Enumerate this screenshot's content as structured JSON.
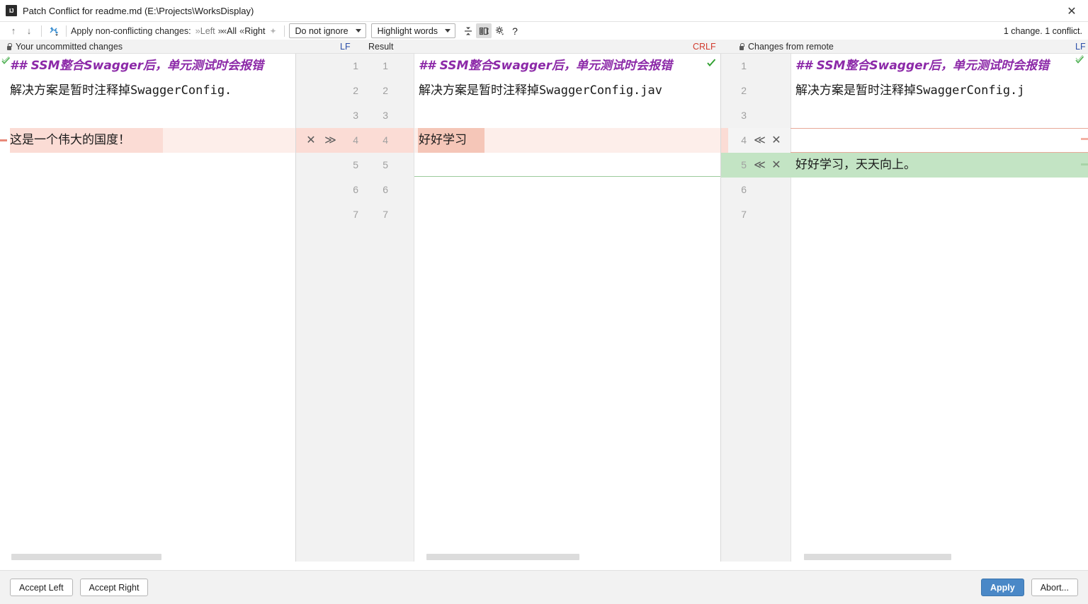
{
  "window": {
    "title": "Patch Conflict for readme.md (E:\\Projects\\WorksDisplay)",
    "app_icon": "intellij-idea-icon",
    "close_label": "✕"
  },
  "toolbar": {
    "prev_change_icon": "arrow-up-icon",
    "next_change_icon": "arrow-down-icon",
    "resolve_icon": "magic-resolve-icon",
    "apply_label": "Apply non-conflicting changes:",
    "apply_left": "Left",
    "apply_all": "All",
    "apply_right": "Right",
    "magic_icon": "magic-wand-icon",
    "ignore_select": "Do not ignore",
    "highlight_select": "Highlight words",
    "collapse_icon": "collapse-unchanged-icon",
    "sync_scroll_icon": "synchronize-scroll-icon",
    "settings_icon": "gear-icon",
    "help_icon": "help-icon",
    "status": "1 change. 1 conflict."
  },
  "panes": {
    "left": {
      "header": "Your uncommitted changes",
      "lock_icon": "lock-icon",
      "lines": [
        {
          "n": "",
          "text": "##  SSM整合Swagger后，单元测试时会报错",
          "style": "md-head"
        },
        {
          "n": "",
          "text": "解决方案是暂时注释掉SwaggerConfig.",
          "style": "plain"
        },
        {
          "n": "",
          "text": "",
          "style": "plain"
        },
        {
          "n": "",
          "text": "这是一个伟大的国度！",
          "style": "plain"
        }
      ]
    },
    "result": {
      "header_lf": "LF",
      "header_result": "Result",
      "header_crlf": "CRLF",
      "line_numbers_left": [
        "1",
        "2",
        "3",
        "4",
        "5",
        "6",
        "7"
      ],
      "line_numbers_right": [
        "1",
        "2",
        "3",
        "4",
        "5",
        "6",
        "7"
      ],
      "lines": [
        {
          "text": "##  SSM整合Swagger后，单元测试时会报错",
          "style": "md-head"
        },
        {
          "text": "解决方案是暂时注释掉SwaggerConfig.jav",
          "style": "plain"
        },
        {
          "text": "",
          "style": "plain"
        },
        {
          "text": "好好学习",
          "style": "plain"
        },
        {
          "text": "",
          "style": "plain"
        }
      ],
      "gutter_actions": {
        "revert_icon": "✕",
        "accept_right_icon": "≫"
      }
    },
    "right": {
      "header": "Changes from remote",
      "lock_icon": "lock-icon",
      "header_lf": "LF",
      "line_numbers": [
        "1",
        "2",
        "3",
        "4",
        "5",
        "6",
        "7"
      ],
      "lines": [
        {
          "text": "##  SSM整合Swagger后，单元测试时会报错",
          "style": "md-head"
        },
        {
          "text": "解决方案是暂时注释掉SwaggerConfig.j",
          "style": "plain"
        },
        {
          "text": "",
          "style": "plain"
        },
        {
          "text": "",
          "style": "plain"
        },
        {
          "text": "好好学习，天天向上。",
          "style": "plain"
        }
      ],
      "gutter_actions": {
        "accept_left_icon": "≪",
        "revert_icon": "✕"
      }
    }
  },
  "footer": {
    "accept_left": "Accept Left",
    "accept_right": "Accept Right",
    "apply": "Apply",
    "abort": "Abort..."
  },
  "colors": {
    "conflict": "#fbdcd5",
    "added": "#c3e4c4",
    "heading": "#8c29a8",
    "accent": "#4a88c7",
    "lf": "#2b4ea8",
    "crlf": "#d13b2e"
  }
}
